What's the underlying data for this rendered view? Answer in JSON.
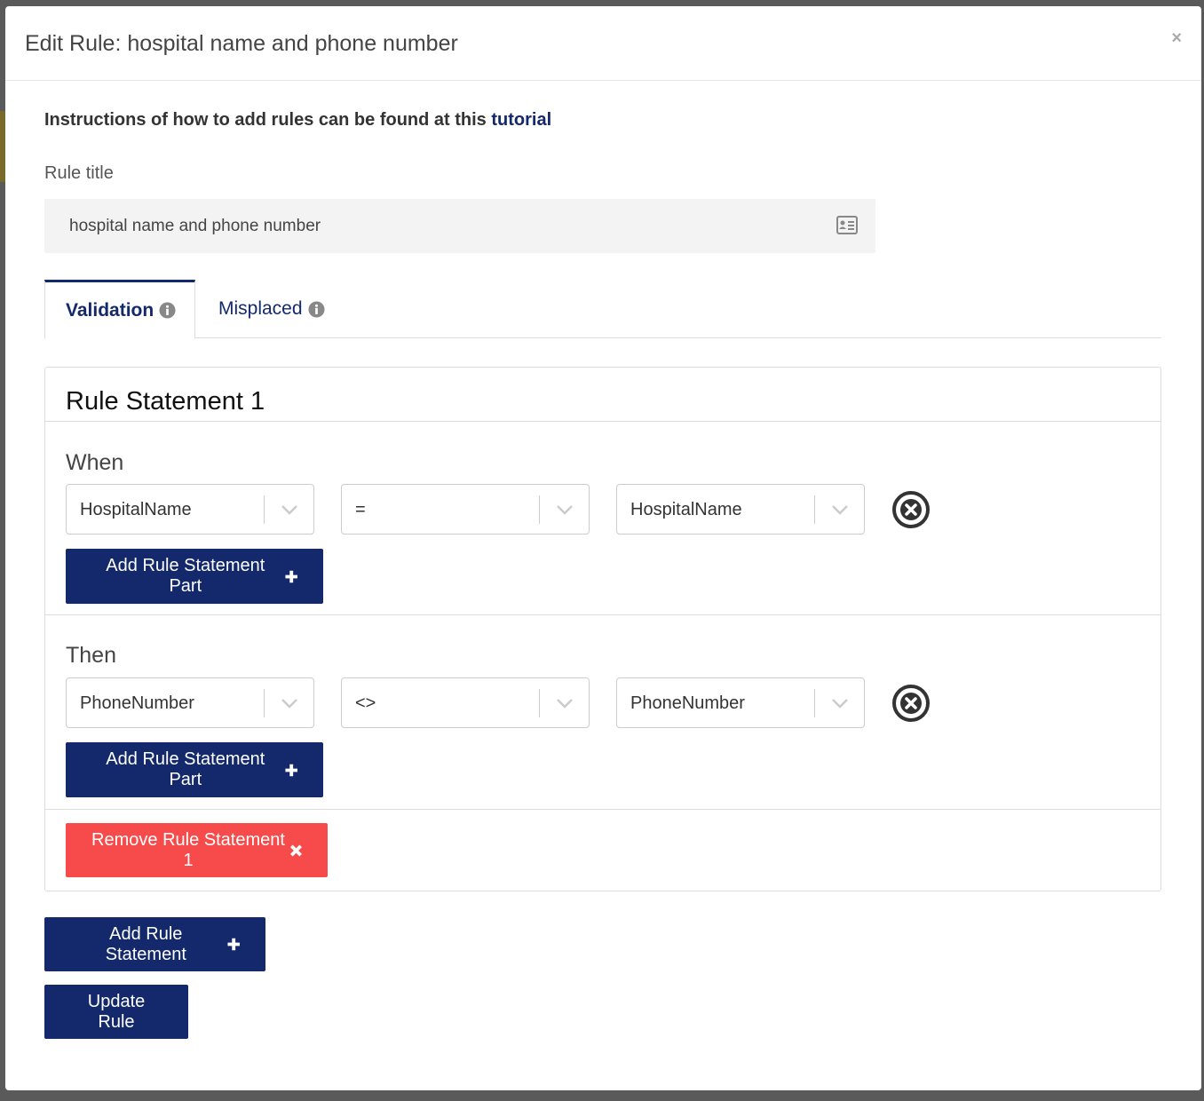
{
  "modal": {
    "title": "Edit Rule: hospital name and phone number",
    "close_label": "×"
  },
  "instructions": {
    "text": "Instructions of how to add rules can be found at this ",
    "link_text": "tutorial"
  },
  "rule_title": {
    "label": "Rule title",
    "value": "hospital name and phone number",
    "icon": "id-card-icon"
  },
  "tabs": [
    {
      "label": "Validation",
      "active": true,
      "icon": "info-circle-icon"
    },
    {
      "label": "Misplaced",
      "active": false,
      "icon": "info-circle-icon"
    }
  ],
  "statement": {
    "title": "Rule Statement 1",
    "when": {
      "label": "When",
      "field": "HospitalName",
      "operator": "=",
      "value": "HospitalName",
      "add_part_label": "Add Rule Statement Part"
    },
    "then": {
      "label": "Then",
      "field": "PhoneNumber",
      "operator": "<>",
      "value": "PhoneNumber",
      "add_part_label": "Add Rule Statement Part"
    },
    "remove_label": "Remove Rule Statement 1"
  },
  "actions": {
    "add_statement_label": "Add Rule Statement",
    "update_label": "Update Rule"
  },
  "colors": {
    "primary": "#13296b",
    "danger": "#f74a4a",
    "input_bg": "#f3f3f3"
  }
}
